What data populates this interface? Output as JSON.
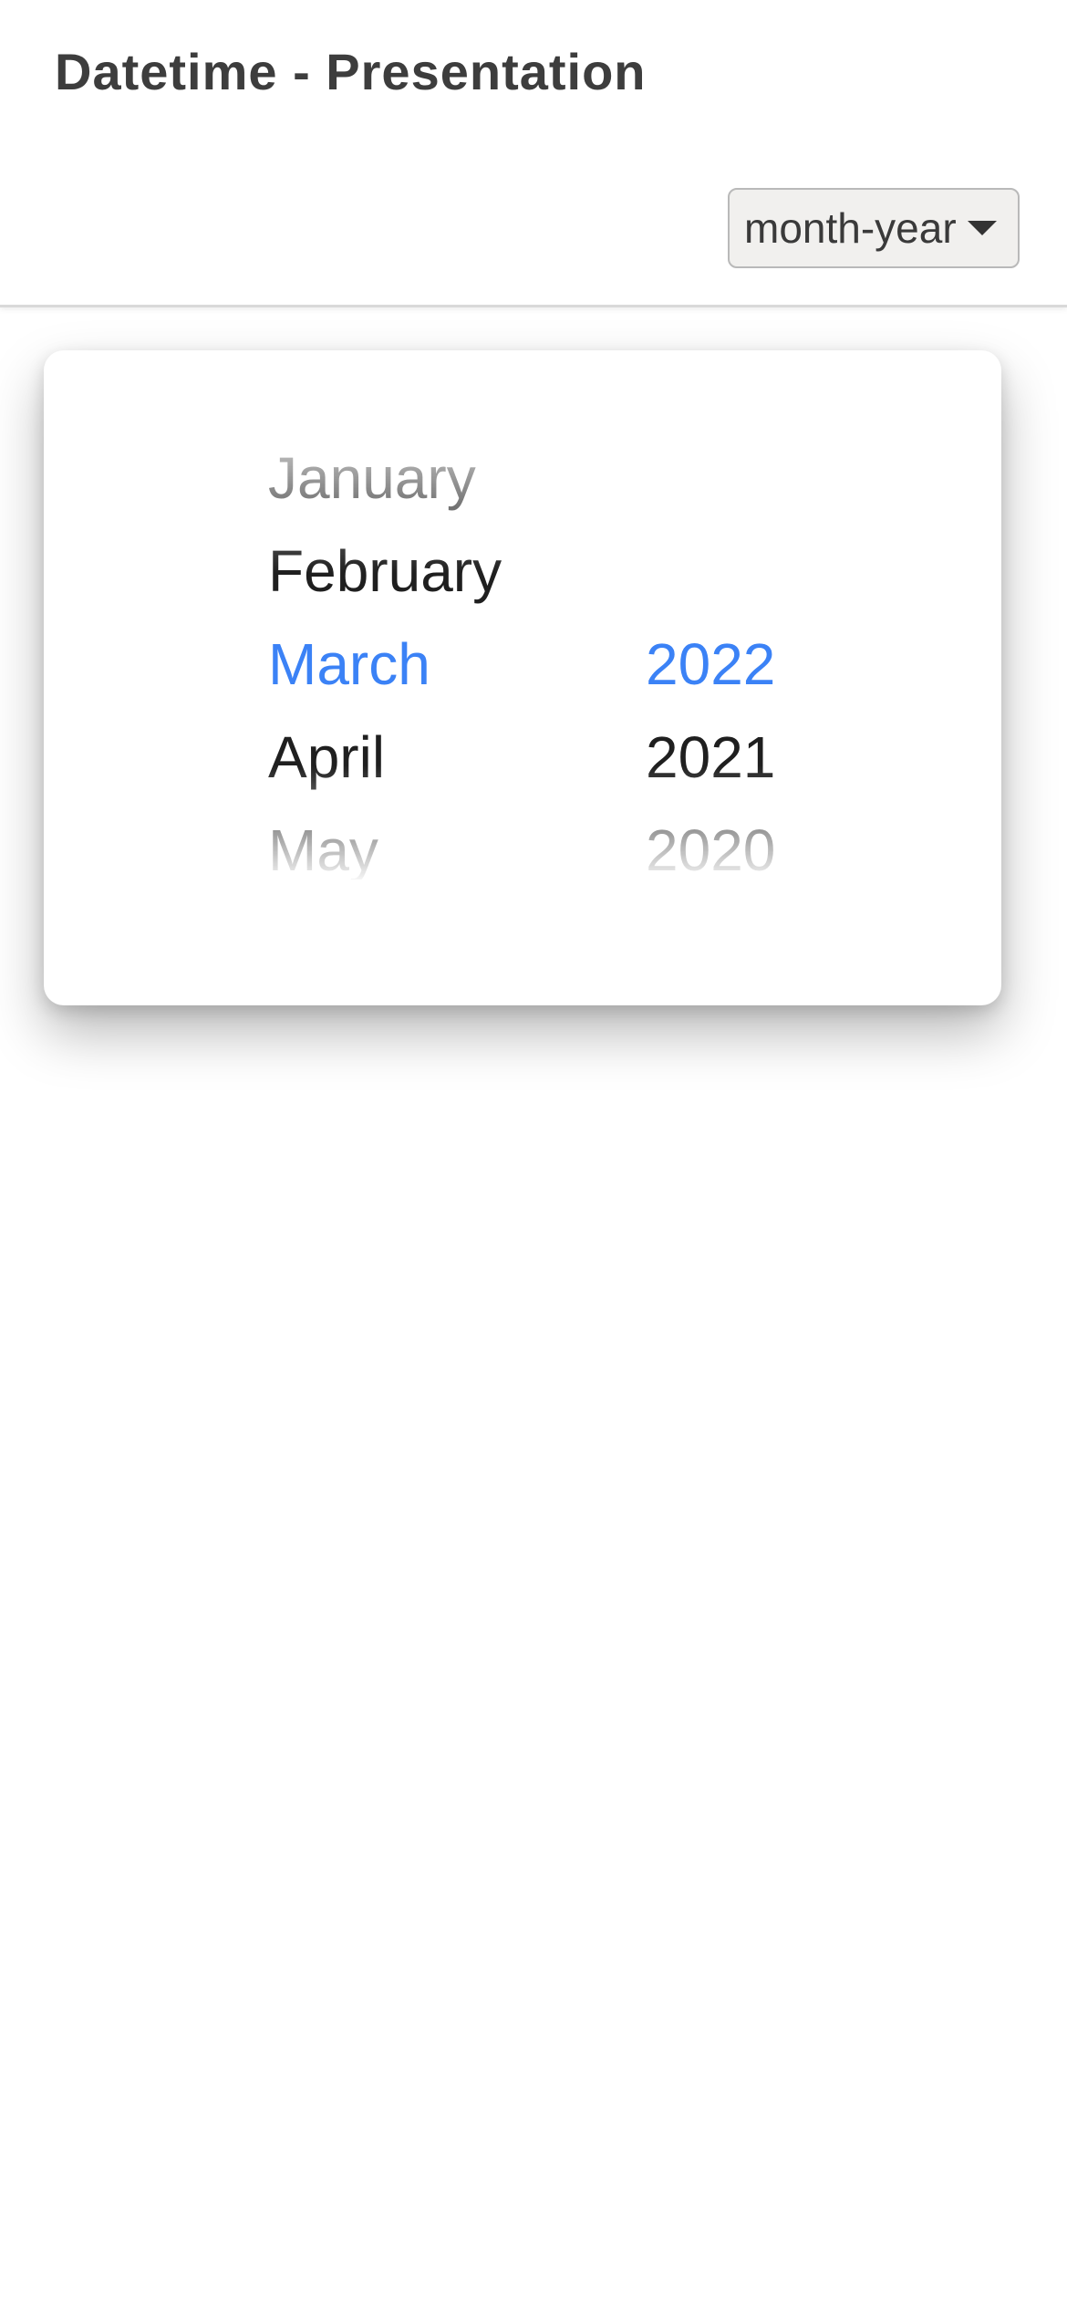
{
  "header": {
    "title": "Datetime - Presentation",
    "presentation_select": {
      "value": "month-year",
      "icon": "caret-down-icon"
    }
  },
  "picker": {
    "months": [
      "January",
      "February",
      "March",
      "April",
      "May"
    ],
    "years": [
      "2022",
      "2021",
      "2020"
    ],
    "selected_month": "March",
    "selected_year": "2022"
  },
  "colors": {
    "accent": "#3b82f6",
    "text": "#1f1f1f",
    "title": "#3d3d3d",
    "select_bg": "#f1f0ee"
  }
}
